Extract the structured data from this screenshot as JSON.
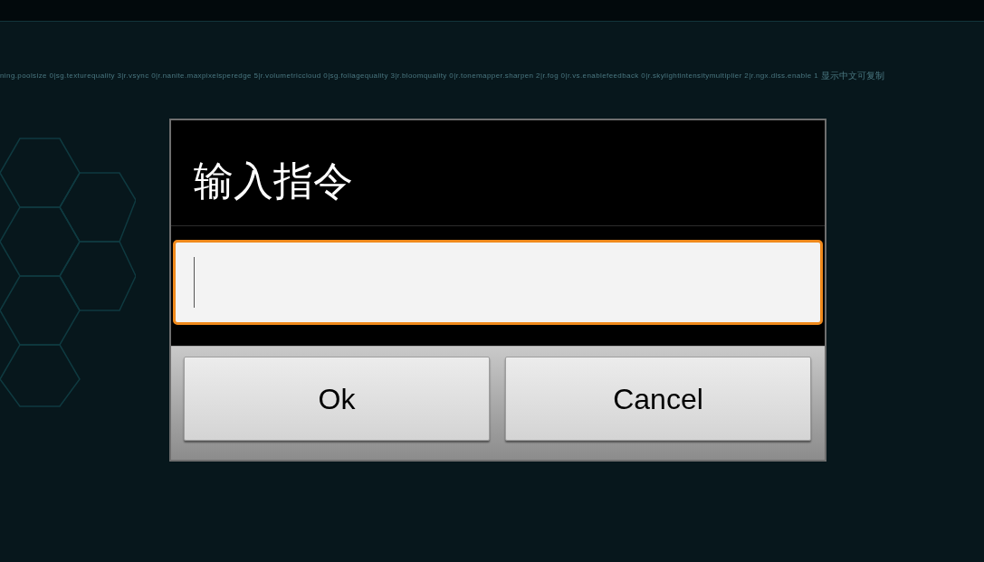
{
  "console": {
    "command_text": "ning.poolsize 0|sg.texturequality 3|r.vsync 0|r.nanite.maxpixelsperedge 5|r.volumetriccloud 0|sg.foliagequality 3|r.bloomquality 0|r.tonemapper.sharpen 2|r.fog 0|r.vs.enablefeedback 0|r.skylightintensitymultiplier 2|r.ngx.dlss.enable 1",
    "note": "显示中文可复制"
  },
  "dialog": {
    "title": "输入指令",
    "input": {
      "focused": true
    },
    "buttons": [
      "Ok",
      "Cancel"
    ]
  }
}
